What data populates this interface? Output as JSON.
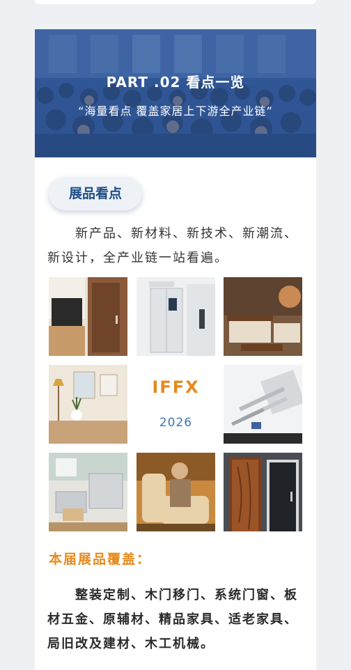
{
  "banner": {
    "title": "PART .02  看点一览",
    "subtitle": "“海量看点  覆盖家居上下游全产业链”"
  },
  "section_pill": "展品看点",
  "intro_text": "新产品、新材料、新技术、新潮流、新设计，全产业链一站看遍。",
  "gallery": {
    "brand": "IFFX",
    "year": "2026",
    "tiles": [
      "wardrobe-and-door-photo",
      "smart-refrigerator-and-lock-photo",
      "wooden-sofa-livingroom-photo",
      "home-decor-vase-lamp-photo",
      "aluminum-profiles-hardware-photo",
      "woodworking-machinery-photo",
      "elderly-care-recliner-photo",
      "wooden-door-and-glass-door-photo"
    ]
  },
  "coverage": {
    "heading": "本届展品覆盖：",
    "text": "整装定制、木门移门、系统门窗、板材五金、原辅材、精品家具、适老家具、局旧改及建材、木工机械。"
  },
  "colors": {
    "accent_orange": "#e68a1e",
    "accent_blue": "#1d4c88",
    "banner_blue": "#3a5e97"
  }
}
